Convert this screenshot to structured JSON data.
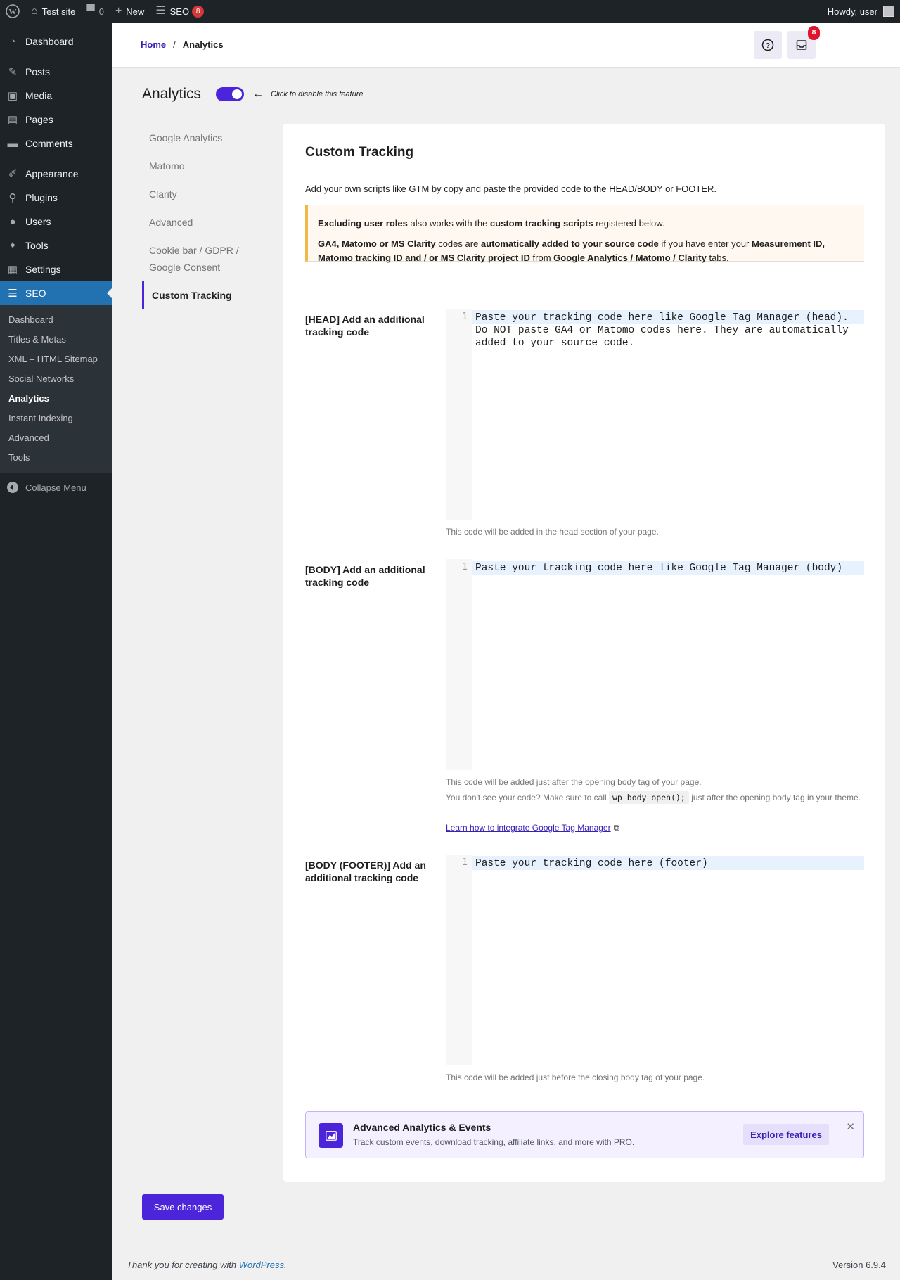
{
  "adminbar": {
    "site_name": "Test site",
    "comments_count": "0",
    "new_label": "New",
    "seo_label": "SEO",
    "seo_badge": "8",
    "howdy": "Howdy, user"
  },
  "sidebar": {
    "items": [
      {
        "label": "Dashboard",
        "icon": "gauge-icon"
      },
      {
        "label": "Posts",
        "icon": "pin-icon"
      },
      {
        "label": "Media",
        "icon": "media-icon"
      },
      {
        "label": "Pages",
        "icon": "pages-icon"
      },
      {
        "label": "Comments",
        "icon": "comment-icon"
      },
      {
        "label": "Appearance",
        "icon": "brush-icon"
      },
      {
        "label": "Plugins",
        "icon": "plug-icon"
      },
      {
        "label": "Users",
        "icon": "user-icon"
      },
      {
        "label": "Tools",
        "icon": "wrench-icon"
      },
      {
        "label": "Settings",
        "icon": "settings-icon"
      },
      {
        "label": "SEO",
        "icon": "seo-icon"
      }
    ],
    "submenu": [
      "Dashboard",
      "Titles & Metas",
      "XML – HTML Sitemap",
      "Social Networks",
      "Analytics",
      "Instant Indexing",
      "Advanced",
      "Tools"
    ],
    "collapse": "Collapse Menu"
  },
  "header": {
    "home": "Home",
    "separator": "/",
    "current": "Analytics",
    "inbox_badge": "8"
  },
  "feature": {
    "title": "Analytics",
    "toggle_on": true,
    "hint": "Click to disable this feature"
  },
  "tabs": [
    "Google Analytics",
    "Matomo",
    "Clarity",
    "Advanced",
    "Cookie bar / GDPR / Google Consent",
    "Custom Tracking"
  ],
  "card": {
    "title": "Custom Tracking",
    "intro": "Add your own scripts like GTM by copy and paste the provided code to the HEAD/BODY or FOOTER.",
    "notice": {
      "p1_a": "Excluding user roles",
      "p1_b": " also works with the ",
      "p1_c": "custom tracking scripts",
      "p1_d": " registered below.",
      "p2_a": "GA4, Matomo or MS Clarity",
      "p2_b": " codes are ",
      "p2_c": "automatically added to your source code",
      "p2_d": " if you have enter your ",
      "p2_e": "Measurement ID, Matomo tracking ID and / or MS Clarity project ID",
      "p2_f": " from ",
      "p2_g": "Google Analytics / Matomo / Clarity",
      "p2_h": " tabs."
    },
    "head": {
      "label": "[HEAD] Add an additional tracking code",
      "line": "1",
      "placeholder": "Paste your tracking code here like Google Tag Manager (head). Do NOT paste GA4 or Matomo codes here. They are automatically added to your source code.",
      "desc": "This code will be added in the head section of your page."
    },
    "body": {
      "label": "[BODY] Add an additional tracking code",
      "line": "1",
      "placeholder": "Paste your tracking code here like Google Tag Manager (body)",
      "desc1": "This code will be added just after the opening body tag of your page.",
      "desc2_a": "You don't see your code? Make sure to call ",
      "desc2_code": "wp_body_open();",
      "desc2_b": " just after the opening body tag in your theme.",
      "link": "Learn how to integrate Google Tag Manager"
    },
    "footer": {
      "label": "[BODY (FOOTER)] Add an additional tracking code",
      "line": "1",
      "placeholder": "Paste your tracking code here (footer)",
      "desc": "This code will be added just before the closing body tag of your page."
    },
    "promo": {
      "title": "Advanced Analytics & Events",
      "text": "Track custom events, download tracking, affiliate links, and more with PRO.",
      "button": "Explore features",
      "close": "✕"
    }
  },
  "save_button": "Save changes",
  "footer": {
    "thanks": "Thank you for creating with ",
    "wp_link": "WordPress",
    "period": ".",
    "version": "Version 6.9.4"
  },
  "colors": {
    "accent": "#4c24d9",
    "wp_blue": "#2271b1",
    "admin_dark": "#1d2327",
    "notice_border": "#f0b849"
  }
}
